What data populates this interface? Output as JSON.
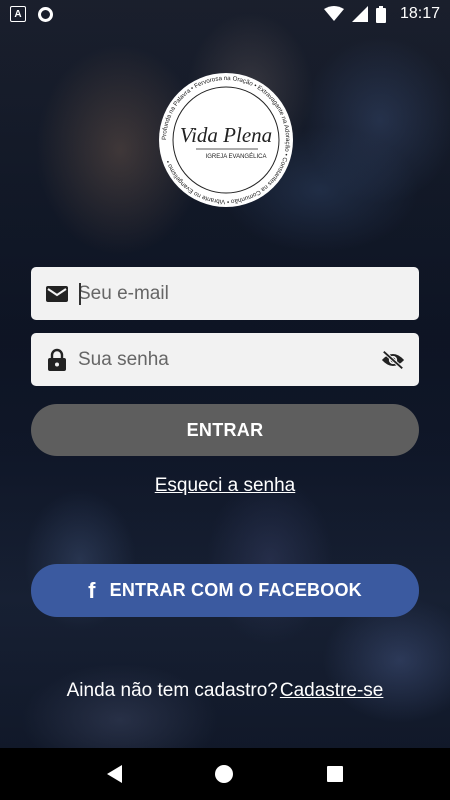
{
  "status_bar": {
    "time": "18:17",
    "icons": [
      "a-notification-icon",
      "circle-notification-icon",
      "wifi-icon",
      "signal-icon",
      "battery-icon"
    ]
  },
  "logo": {
    "brand_script": "Vida Plena",
    "brand_subtitle": "IGREJA EVANGÉLICA",
    "ring_text": "Profunda na Palavra • Fervorosa na Oração • Extravagante na Adoração • Constantes na Comunhão • Vibrante no Evangelismo •"
  },
  "login": {
    "email_placeholder": "Seu e-mail",
    "email_value": "",
    "password_placeholder": "Sua senha",
    "password_value": "",
    "enter_label": "ENTRAR",
    "forgot_label": "Esqueci a senha",
    "facebook_label": "ENTRAR COM O FACEBOOK",
    "signup_prompt": "Ainda não tem cadastro?",
    "signup_link": "Cadastre-se"
  },
  "colors": {
    "facebook_blue": "#3b5aa0",
    "enter_gray": "#5e5e5e",
    "field_bg": "#f2f2f2"
  }
}
